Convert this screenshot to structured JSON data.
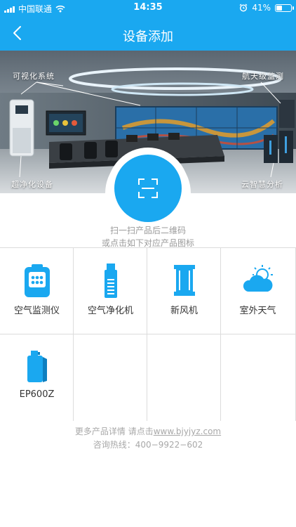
{
  "status_bar": {
    "carrier": "中国联通",
    "time": "14:35",
    "battery": "41%",
    "battery_level": 0.41
  },
  "nav": {
    "title": "设备添加",
    "back_icon": "chevron-left-icon"
  },
  "hero": {
    "labels": {
      "visual_system": "可视化系统",
      "aerospace": "航天级监测",
      "purifier": "超净化设备",
      "cloud": "云智慧分析"
    }
  },
  "scan": {
    "icon": "scan-icon",
    "hint_line1": "扫一扫产品后二维码",
    "hint_line2": "或点击如下对应产品图标"
  },
  "products": [
    {
      "label": "空气监测仪",
      "icon": "air-monitor-icon"
    },
    {
      "label": "空气净化机",
      "icon": "air-purifier-icon"
    },
    {
      "label": "新风机",
      "icon": "fresh-air-unit-icon"
    },
    {
      "label": "室外天气",
      "icon": "weather-icon"
    },
    {
      "label": "EP600Z",
      "icon": "ep600z-device-icon"
    }
  ],
  "footer": {
    "more_prefix": "更多产品详情  请点击",
    "url": "www.bjyjyz.com",
    "hotline": "咨询热线：400−9922−602"
  },
  "colors": {
    "primary": "#1aa8f0",
    "grid_line": "#dcdcdc",
    "hint_text": "#9a9a9a"
  }
}
